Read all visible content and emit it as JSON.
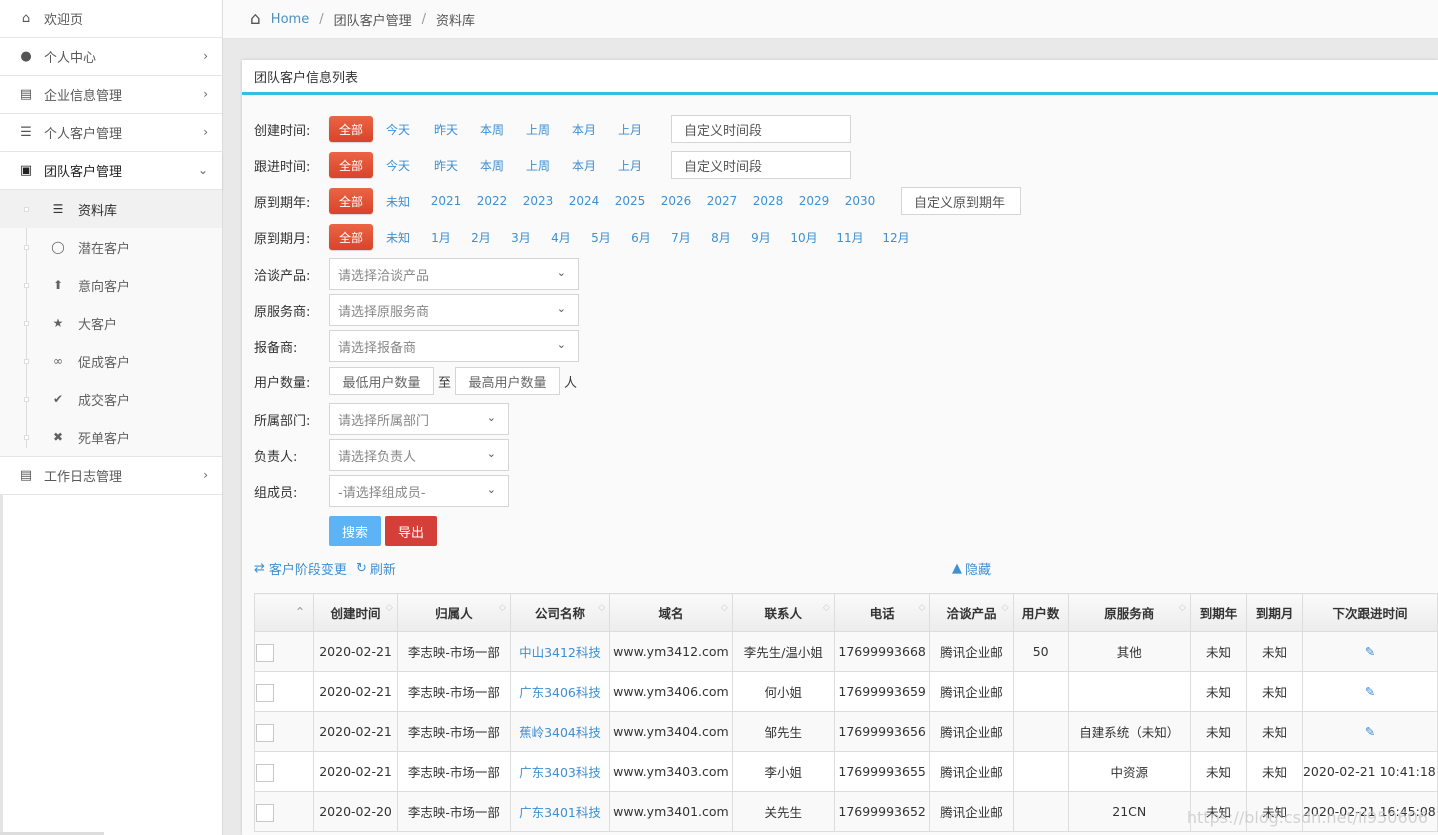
{
  "sidebar": {
    "items": [
      {
        "label": "欢迎页",
        "icon": "home-icon"
      },
      {
        "label": "个人中心",
        "icon": "user-icon"
      },
      {
        "label": "企业信息管理",
        "icon": "bar-chart-icon"
      },
      {
        "label": "个人客户管理",
        "icon": "list-icon"
      },
      {
        "label": "团队客户管理",
        "icon": "desktop-icon"
      },
      {
        "label": "工作日志管理",
        "icon": "list-alt-icon"
      }
    ],
    "sub_items": [
      {
        "label": "资料库",
        "icon": "tasks-icon"
      },
      {
        "label": "潜在客户",
        "icon": "github-icon"
      },
      {
        "label": "意向客户",
        "icon": "upload-icon"
      },
      {
        "label": "大客户",
        "icon": "star-icon"
      },
      {
        "label": "促成客户",
        "icon": "chain-broken-icon"
      },
      {
        "label": "成交客户",
        "icon": "check-circle-icon"
      },
      {
        "label": "死单客户",
        "icon": "times-circle-icon"
      }
    ]
  },
  "breadcrumb": {
    "home": "Home",
    "level1": "团队客户管理",
    "level2": "资料库"
  },
  "panel": {
    "title": "团队客户信息列表"
  },
  "filters": {
    "created": {
      "label": "创建时间:",
      "all": "全部",
      "options": [
        "今天",
        "昨天",
        "本周",
        "上周",
        "本月",
        "上月"
      ],
      "custom": "自定义时间段"
    },
    "followup": {
      "label": "跟进时间:",
      "all": "全部",
      "options": [
        "今天",
        "昨天",
        "本周",
        "上周",
        "本月",
        "上月"
      ],
      "custom": "自定义时间段"
    },
    "expire_year": {
      "label": "原到期年:",
      "all": "全部",
      "options": [
        "未知",
        "2021",
        "2022",
        "2023",
        "2024",
        "2025",
        "2026",
        "2027",
        "2028",
        "2029",
        "2030"
      ],
      "custom": "自定义原到期年"
    },
    "expire_month": {
      "label": "原到期月:",
      "all": "全部",
      "options": [
        "未知",
        "1月",
        "2月",
        "3月",
        "4月",
        "5月",
        "6月",
        "7月",
        "8月",
        "9月",
        "10月",
        "11月",
        "12月"
      ]
    },
    "product": {
      "label": "洽谈产品:",
      "placeholder": "请选择洽谈产品"
    },
    "provider": {
      "label": "原服务商:",
      "placeholder": "请选择原服务商"
    },
    "reporter": {
      "label": "报备商:",
      "placeholder": "请选择报备商"
    },
    "users": {
      "label": "用户数量:",
      "min_placeholder": "最低用户数量",
      "to": "至",
      "max_placeholder": "最高用户数量",
      "unit": "人"
    },
    "department": {
      "label": "所属部门:",
      "placeholder": "请选择所属部门"
    },
    "owner": {
      "label": "负责人:",
      "placeholder": "请选择负责人"
    },
    "member": {
      "label": "组成员:",
      "placeholder": "-请选择组成员-"
    },
    "search_label": "搜索",
    "export_label": "导出"
  },
  "toolbar": {
    "stage_change": "客户阶段变更",
    "refresh": "刷新",
    "hide": "隐藏"
  },
  "table": {
    "columns": [
      "创建时间",
      "归属人",
      "公司名称",
      "域名",
      "联系人",
      "电话",
      "洽谈产品",
      "用户数",
      "原服务商",
      "到期年",
      "到期月",
      "下次跟进时间"
    ],
    "rows": [
      {
        "created": "2020-02-21",
        "owner": "李志映-市场一部",
        "company": "中山3412科技",
        "domain": "www.ym3412.com",
        "contact": "李先生/温小姐",
        "phone": "17699993668",
        "product": "腾讯企业邮",
        "users": "50",
        "provider": "其他",
        "year": "未知",
        "month": "未知",
        "next": ""
      },
      {
        "created": "2020-02-21",
        "owner": "李志映-市场一部",
        "company": "广东3406科技",
        "domain": "www.ym3406.com",
        "contact": "何小姐",
        "phone": "17699993659",
        "product": "腾讯企业邮",
        "users": "",
        "provider": "",
        "year": "未知",
        "month": "未知",
        "next": ""
      },
      {
        "created": "2020-02-21",
        "owner": "李志映-市场一部",
        "company": "蕉岭3404科技",
        "domain": "www.ym3404.com",
        "contact": "邹先生",
        "phone": "17699993656",
        "product": "腾讯企业邮",
        "users": "",
        "provider": "自建系统（未知）",
        "year": "未知",
        "month": "未知",
        "next": ""
      },
      {
        "created": "2020-02-21",
        "owner": "李志映-市场一部",
        "company": "广东3403科技",
        "domain": "www.ym3403.com",
        "contact": "李小姐",
        "phone": "17699993655",
        "product": "腾讯企业邮",
        "users": "",
        "provider": "中资源",
        "year": "未知",
        "month": "未知",
        "next": "2020-02-21 10:41:18"
      },
      {
        "created": "2020-02-20",
        "owner": "李志映-市场一部",
        "company": "广东3401科技",
        "domain": "www.ym3401.com",
        "contact": "关先生",
        "phone": "17699993652",
        "product": "腾讯企业邮",
        "users": "",
        "provider": "21CN",
        "year": "未知",
        "month": "未知",
        "next": "2020-02-21 16:45:08"
      }
    ]
  },
  "watermark": "https://blog.csdn.net/li950606"
}
